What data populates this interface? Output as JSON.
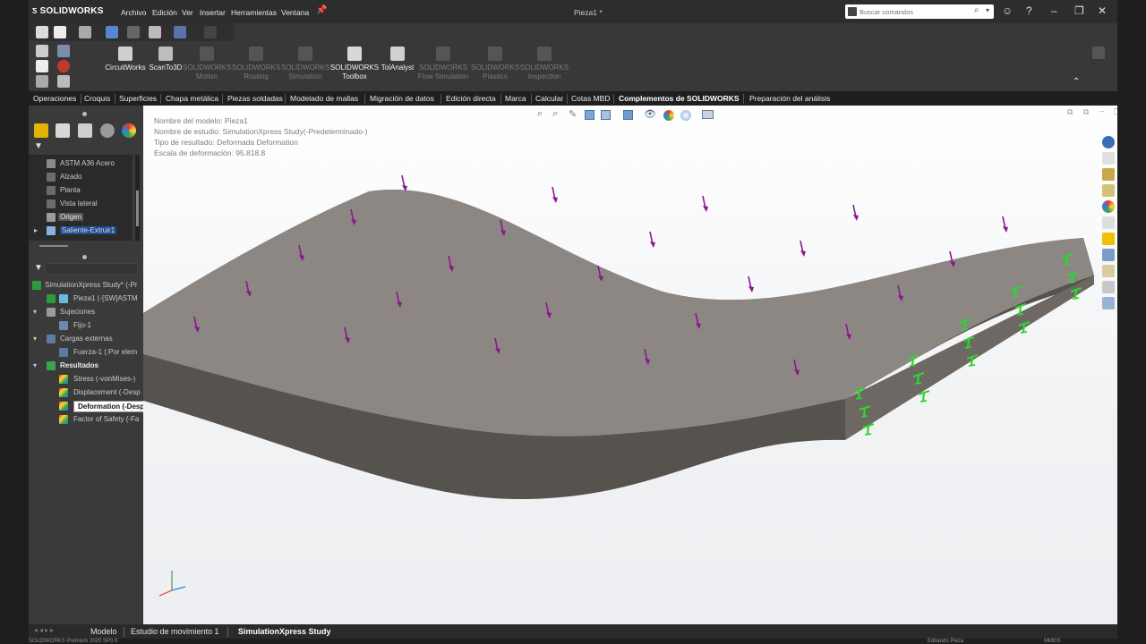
{
  "titlebar": {
    "logo": "SOLIDWORKS",
    "menu": [
      "Archivo",
      "Edición",
      "Ver",
      "Insertar",
      "Herramientas",
      "Ventana"
    ],
    "document_title": "Pieza1 *",
    "search_placeholder": "Buscar comandos"
  },
  "ribbon": {
    "buttons": [
      {
        "label": "CircuitWorks",
        "enabled": true
      },
      {
        "label": "ScanTo3D",
        "enabled": true
      },
      {
        "label": "SOLIDWORKS Motion",
        "enabled": false
      },
      {
        "label": "SOLIDWORKS Routing",
        "enabled": false
      },
      {
        "label": "SOLIDWORKS Simulation",
        "enabled": false
      },
      {
        "label": "SOLIDWORKS Toolbox",
        "enabled": true
      },
      {
        "label": "TolAnalyst",
        "enabled": true
      },
      {
        "label": "SOLIDWORKS Flow Simulation",
        "enabled": false
      },
      {
        "label": "SOLIDWORKS Plastics",
        "enabled": false
      },
      {
        "label": "SOLIDWORKS Inspection",
        "enabled": false
      }
    ]
  },
  "tabs": {
    "items": [
      "Operaciones",
      "Croquis",
      "Superficies",
      "Chapa metálica",
      "Piezas soldadas",
      "Modelado de mallas",
      "Migración de datos",
      "Edición directa",
      "Marca",
      "Calcular",
      "Cotas MBD",
      "Complementos de SOLIDWORKS",
      "Preparación del análisis"
    ],
    "active": "Complementos de SOLIDWORKS"
  },
  "tree_top": {
    "items": [
      "ASTM A36 Acero",
      "Alzado",
      "Planta",
      "Vista lateral",
      "Origen",
      "Saliente-Extruir1"
    ]
  },
  "tree_bottom": {
    "study": "SimulationXpress Study* (-Pr",
    "part": "Pieza1 (-[SW]ASTM",
    "fixtures": "Sujeciones",
    "fixture_item": "Fijo-1",
    "loads": "Cargas externas",
    "load_item": "Fuerza-1 (:Por elem",
    "results": "Resultados",
    "result_items": [
      "Stress (-vonMises-)",
      "Displacement (-Desp",
      "Deformation (-Desplazamiento-)",
      "Factor of Safety (-Fa"
    ],
    "tooltip": "Deformation (-Desplazamiento-)"
  },
  "viewport": {
    "info_lines": [
      "Nombre del modelo: Pieza1",
      "Nombre de estudio: SimulationXpress Study(-Predeterminado-)",
      "Tipo de resultado: Deformada Deformation",
      "Escala de deformación: 95.818.8"
    ],
    "colors": {
      "part_top": "#8c8783",
      "part_side": "#5e5a56",
      "load_arrow": "#8b168f",
      "fixture": "#2fd62f"
    }
  },
  "bottom_tabs": {
    "items": [
      "Modelo",
      "Estudio de movimiento 1",
      "SimulationXpress Study"
    ],
    "active": "SimulationXpress Study"
  },
  "statusbar": {
    "left": "SOLIDWORKS Premium 2020 SP0.0",
    "right_a": "Editando Pieza",
    "right_b": "MMGS"
  }
}
